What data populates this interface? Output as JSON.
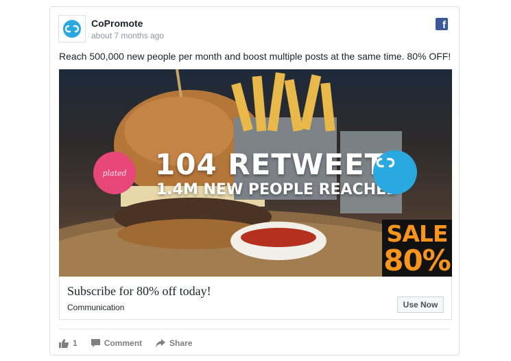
{
  "post": {
    "page_name": "CoPromote",
    "timestamp": "about 7 months ago",
    "text": "Reach 500,000 new people per month and boost multiple posts at the same time. 80% OFF!",
    "platform_icon": "facebook-icon",
    "fb_letter": "f"
  },
  "ad": {
    "headline": "104 RETWEETS",
    "subheadline": "1.4M NEW PEOPLE REACHED",
    "brand_badge": "plated",
    "sale_word": "SALE",
    "sale_percent": "80%"
  },
  "link": {
    "title": "Subscribe for 80% off today!",
    "subtitle": "Communication",
    "cta_label": "Use Now"
  },
  "actions": {
    "like_count": "1",
    "comment_label": "Comment",
    "share_label": "Share"
  },
  "colors": {
    "brand_blue": "#29a9e0",
    "facebook_blue": "#3b5998",
    "plated_pink": "#e8477a",
    "sale_orange": "#f7941d"
  }
}
